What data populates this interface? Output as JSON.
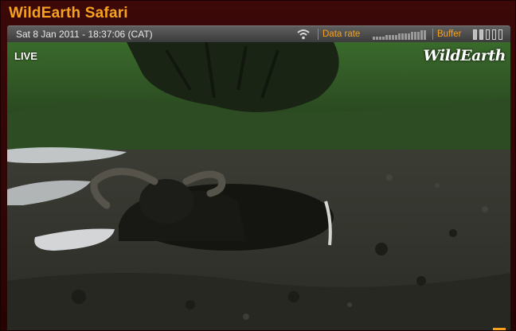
{
  "app": {
    "title": "WildEarth Safari"
  },
  "status_bar": {
    "datetime": "Sat 8 Jan 2011 - 18:37:06 (CAT)",
    "data_rate_label": "Data rate",
    "buffer_label": "Buffer",
    "buffer_level": 0.5,
    "icons": [
      "wifi-icon",
      "data-rate-meter",
      "buffer-meter"
    ]
  },
  "video": {
    "live_label": "LIVE",
    "watermark": "WildEarth",
    "description_note_only_layout": ""
  },
  "colors": {
    "accent": "#f6a21e",
    "frame": "#3c0808",
    "status_bar": "#4b4b4b"
  }
}
